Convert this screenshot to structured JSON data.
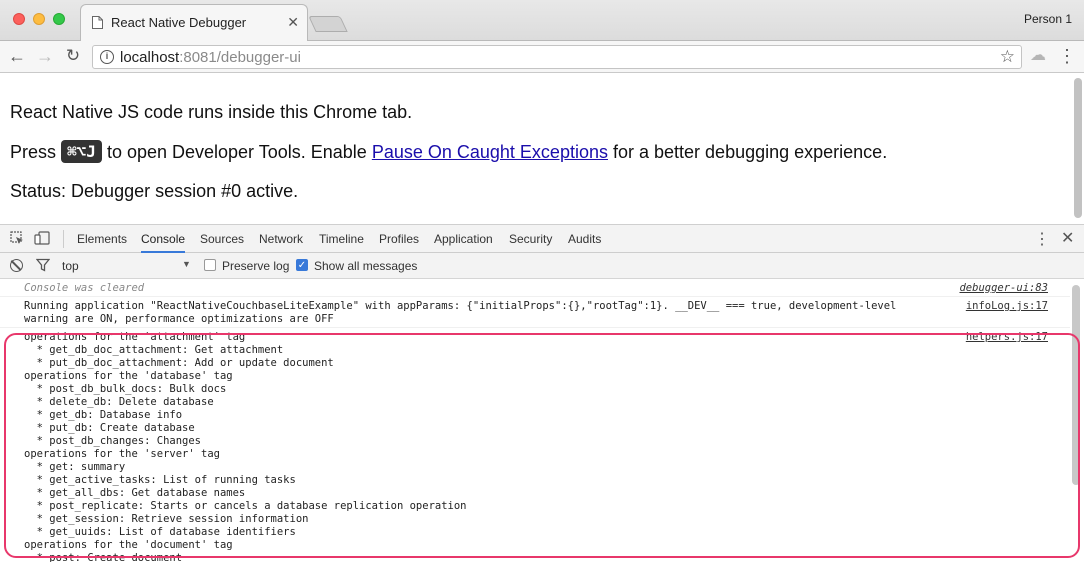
{
  "window": {
    "tab_title": "React Native Debugger",
    "tab_close": "✕",
    "profile": "Person 1"
  },
  "toolbar": {
    "url_host": "localhost",
    "url_rest": ":8081/debugger-ui"
  },
  "page": {
    "line1": "React Native JS code runs inside this Chrome tab.",
    "line2_prefix": "Press",
    "shortcut": "⌘⌥J",
    "line2_middle": "to open Developer Tools. Enable",
    "link": "Pause On Caught Exceptions",
    "line2_suffix": "for a better debugging experience.",
    "status": "Status: Debugger session #0 active."
  },
  "devtools": {
    "tabs": [
      "Elements",
      "Console",
      "Sources",
      "Network",
      "Timeline",
      "Profiles",
      "Application",
      "Security",
      "Audits"
    ],
    "active_tab": "Console",
    "context": "top",
    "preserve_log_label": "Preserve log",
    "preserve_log_checked": false,
    "show_all_label": "Show all messages",
    "show_all_checked": true
  },
  "console": {
    "messages": [
      {
        "text": "Console was cleared",
        "source": "debugger-ui:83",
        "kind": "cleared"
      },
      {
        "text": "Running application \"ReactNativeCouchbaseLiteExample\" with appParams: {\"initialProps\":{},\"rootTag\":1}. __DEV__ === true, development-level\nwarning are ON, performance optimizations are OFF",
        "source": "infoLog.js:17",
        "kind": "log"
      },
      {
        "text": "operations for the 'attachment' tag\n  * get_db_doc_attachment: Get attachment\n  * put_db_doc_attachment: Add or update document\noperations for the 'database' tag\n  * post_db_bulk_docs: Bulk docs\n  * delete_db: Delete database\n  * get_db: Database info\n  * put_db: Create database\n  * post_db_changes: Changes\noperations for the 'server' tag\n  * get: summary\n  * get_active_tasks: List of running tasks\n  * get_all_dbs: Get database names\n  * post_replicate: Starts or cancels a database replication operation\n  * get_session: Retrieve session information\n  * get_uuids: List of database identifiers\noperations for the 'document' tag\n  * post: Create document",
        "source": "helpers.js:17",
        "kind": "log"
      }
    ]
  },
  "colors": {
    "highlight": "#e8376b",
    "active_tab": "#3879d9",
    "link": "#1a0dab"
  }
}
